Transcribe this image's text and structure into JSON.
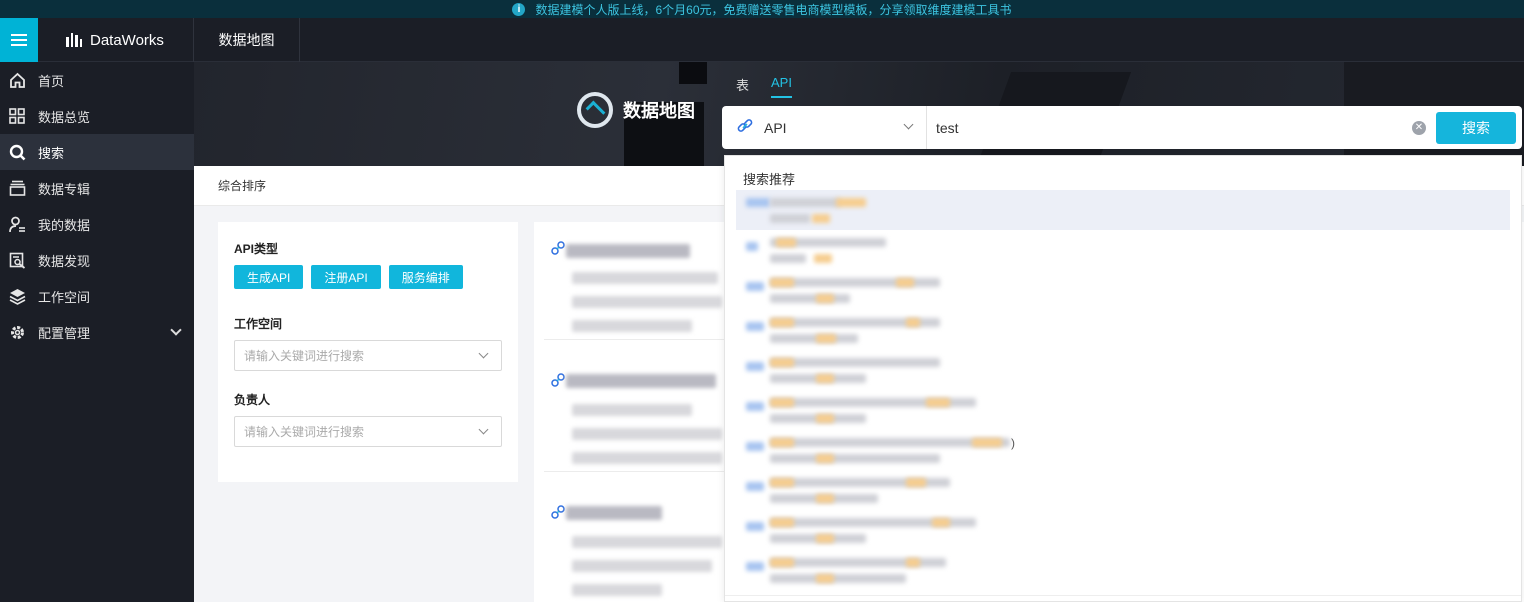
{
  "announcement": {
    "text": "数据建模个人版上线，6个月60元，免费赠送零售电商模型模板，分享领取维度建模工具书"
  },
  "topbar": {
    "brand": "DataWorks",
    "module": "数据地图"
  },
  "sidebar": {
    "items": [
      {
        "label": "首页",
        "icon": "home-icon"
      },
      {
        "label": "数据总览",
        "icon": "grid-icon"
      },
      {
        "label": "搜索",
        "icon": "search-icon",
        "active": true
      },
      {
        "label": "数据专辑",
        "icon": "album-icon"
      },
      {
        "label": "我的数据",
        "icon": "user-data-icon"
      },
      {
        "label": "数据发现",
        "icon": "data-discovery-icon"
      },
      {
        "label": "工作空间",
        "icon": "layers-icon"
      },
      {
        "label": "配置管理",
        "icon": "gear-icon"
      }
    ]
  },
  "banner": {
    "title": "数据地图"
  },
  "search": {
    "tabs": [
      {
        "label": "表"
      },
      {
        "label": "API",
        "active": true
      }
    ],
    "type": "API",
    "query": "test",
    "button": "搜索"
  },
  "sort": {
    "label": "综合排序"
  },
  "filter": {
    "api_type_label": "API类型",
    "chips": [
      "生成API",
      "注册API",
      "服务编排"
    ],
    "workspace_label": "工作空间",
    "workspace_placeholder": "请输入关键词进行搜索",
    "owner_label": "负责人",
    "owner_placeholder": "请输入关键词进行搜索"
  },
  "dropdown": {
    "title": "搜索推荐",
    "paren": ")"
  },
  "colors": {
    "accent": "#15b5dc",
    "sidebar_bg": "#1b1e26",
    "announce_bg": "#0a2f3c"
  }
}
